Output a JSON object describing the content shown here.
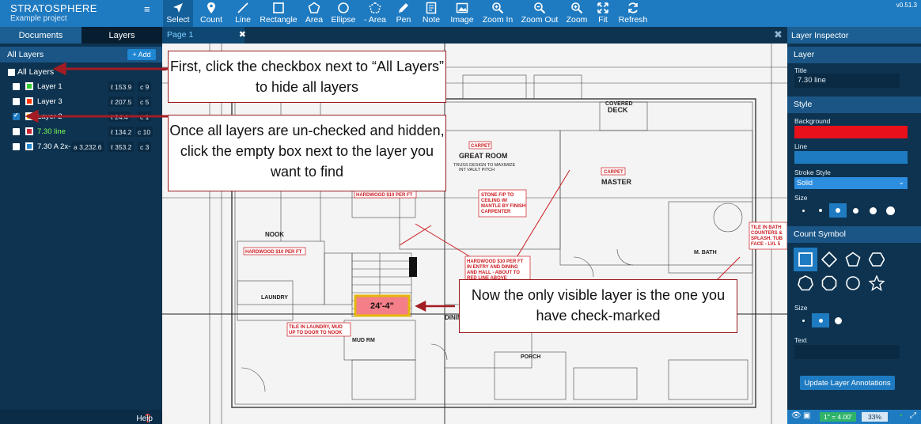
{
  "app": {
    "name": "STRATOSPHERE",
    "project": "Example project",
    "menu_glyph": "≡",
    "version": "v0.51.3"
  },
  "toolbar": {
    "tools": [
      {
        "id": "select",
        "label": "Select",
        "icon": "cursor-icon",
        "active": true
      },
      {
        "id": "count",
        "label": "Count",
        "icon": "pin-icon"
      },
      {
        "id": "line",
        "label": "Line",
        "icon": "line-icon"
      },
      {
        "id": "rectangle",
        "label": "Rectangle",
        "icon": "rectangle-icon"
      },
      {
        "id": "area",
        "label": "Area",
        "icon": "pentagon-icon"
      },
      {
        "id": "ellipse",
        "label": "Ellipse",
        "icon": "ellipse-icon"
      },
      {
        "id": "minus-area",
        "label": "- Area",
        "icon": "dashed-pentagon-icon"
      },
      {
        "id": "pen",
        "label": "Pen",
        "icon": "pen-icon"
      },
      {
        "id": "note",
        "label": "Note",
        "icon": "note-icon"
      },
      {
        "id": "image",
        "label": "Image",
        "icon": "image-icon"
      },
      {
        "id": "zoom-in",
        "label": "Zoom In",
        "icon": "zoom-in-icon"
      },
      {
        "id": "zoom-out",
        "label": "Zoom Out",
        "icon": "zoom-out-icon"
      },
      {
        "id": "zoom",
        "label": "Zoom",
        "icon": "zoom-icon"
      },
      {
        "id": "fit",
        "label": "Fit",
        "icon": "fit-icon"
      },
      {
        "id": "refresh",
        "label": "Refresh",
        "icon": "refresh-icon"
      }
    ]
  },
  "left_panel": {
    "tabs": {
      "documents": "Documents",
      "layers": "Layers"
    },
    "header": "All Layers",
    "add_label": "+ Add",
    "all_layers_label": "All Layers",
    "layers": [
      {
        "name": "Layer 1",
        "color": "#33cc33",
        "length": "ℓ 153.9",
        "count": "c 9",
        "checked": false
      },
      {
        "name": "Layer 3",
        "color": "#ff3300",
        "length": "ℓ 207.5",
        "count": "c 5",
        "checked": false
      },
      {
        "name": "Layer 2",
        "color": "#ffcc00",
        "length": "ℓ 24.4",
        "count": "c 1",
        "checked": true
      },
      {
        "name": "7.30 line",
        "color": "#cc2233",
        "length": "ℓ 134.2",
        "count": "c 10",
        "checked": false,
        "highlight": true
      },
      {
        "name": "7.30 A 2x-",
        "color": "#1f86d2",
        "area": "a 3,232.6",
        "length": "ℓ 353.2",
        "count": "c 3",
        "checked": false
      }
    ],
    "help_label": "Help",
    "help_icon": "question-icon"
  },
  "center": {
    "page_tab": "Page 1",
    "close_glyph": "✖"
  },
  "plan_labels": {
    "covered_deck": "COVERED\nDECK",
    "great_room": "GREAT ROOM",
    "truss_note": "TRUSS DESIGN TO MAXIMIZE\nINT VAULT PITCH",
    "carpet": "CARPET",
    "master": "MASTER",
    "nook": "NOOK",
    "laundry": "LAUNDRY",
    "mud_rm": "MUD RM",
    "dining": "DINING",
    "porch": "PORCH",
    "m_bath": "M. BATH",
    "hardwood_1": "HARDWOOD $10 PER FT",
    "hardwood_2": "HARDWOOD $10 PER FT",
    "hardwood_3": "HARDWOOD $10 PER FT\nIN ENTRY AND DINING\nAND HALL - ABOUT TO\nRED LINE ABOVE",
    "stone_note": "STONE F/P TO\nCEILING W/\nMANTLE BY FINISH\nCARPENTER",
    "tile_note": "TILE IN LAUNDRY, MUD\nUP TO DOOR TO NOOK",
    "tile_bath": "TILE IN BATH\nCOUNTERS &\nSPLASH, TUB\nFACE - LVL 5",
    "dimension": "24'-4\""
  },
  "callouts": {
    "first": "First, click the checkbox next to “All Layers” to hide all layers",
    "second": "Once all layers are un-checked and hidden, click the empty box next to the layer you want to find",
    "third": "Now the only visible layer is the one you have check-marked"
  },
  "inspector": {
    "title": "Layer Inspector",
    "layer_section": "Layer",
    "title_label": "Title",
    "title_value": "7.30 line",
    "style_section": "Style",
    "background_label": "Background",
    "background_color": "#e8101a",
    "line_label": "Line",
    "line_color": "#1f7bc1",
    "stroke_style_label": "Stroke Style",
    "stroke_style_value": "Solid",
    "size_label": "Size",
    "count_symbol_section": "Count Symbol",
    "symbol_size_label": "Size",
    "text_label": "Text",
    "text_value": "",
    "update_button": "Update Layer Annotations",
    "scale": "1\" = 4.00'",
    "zoom": "33%"
  }
}
